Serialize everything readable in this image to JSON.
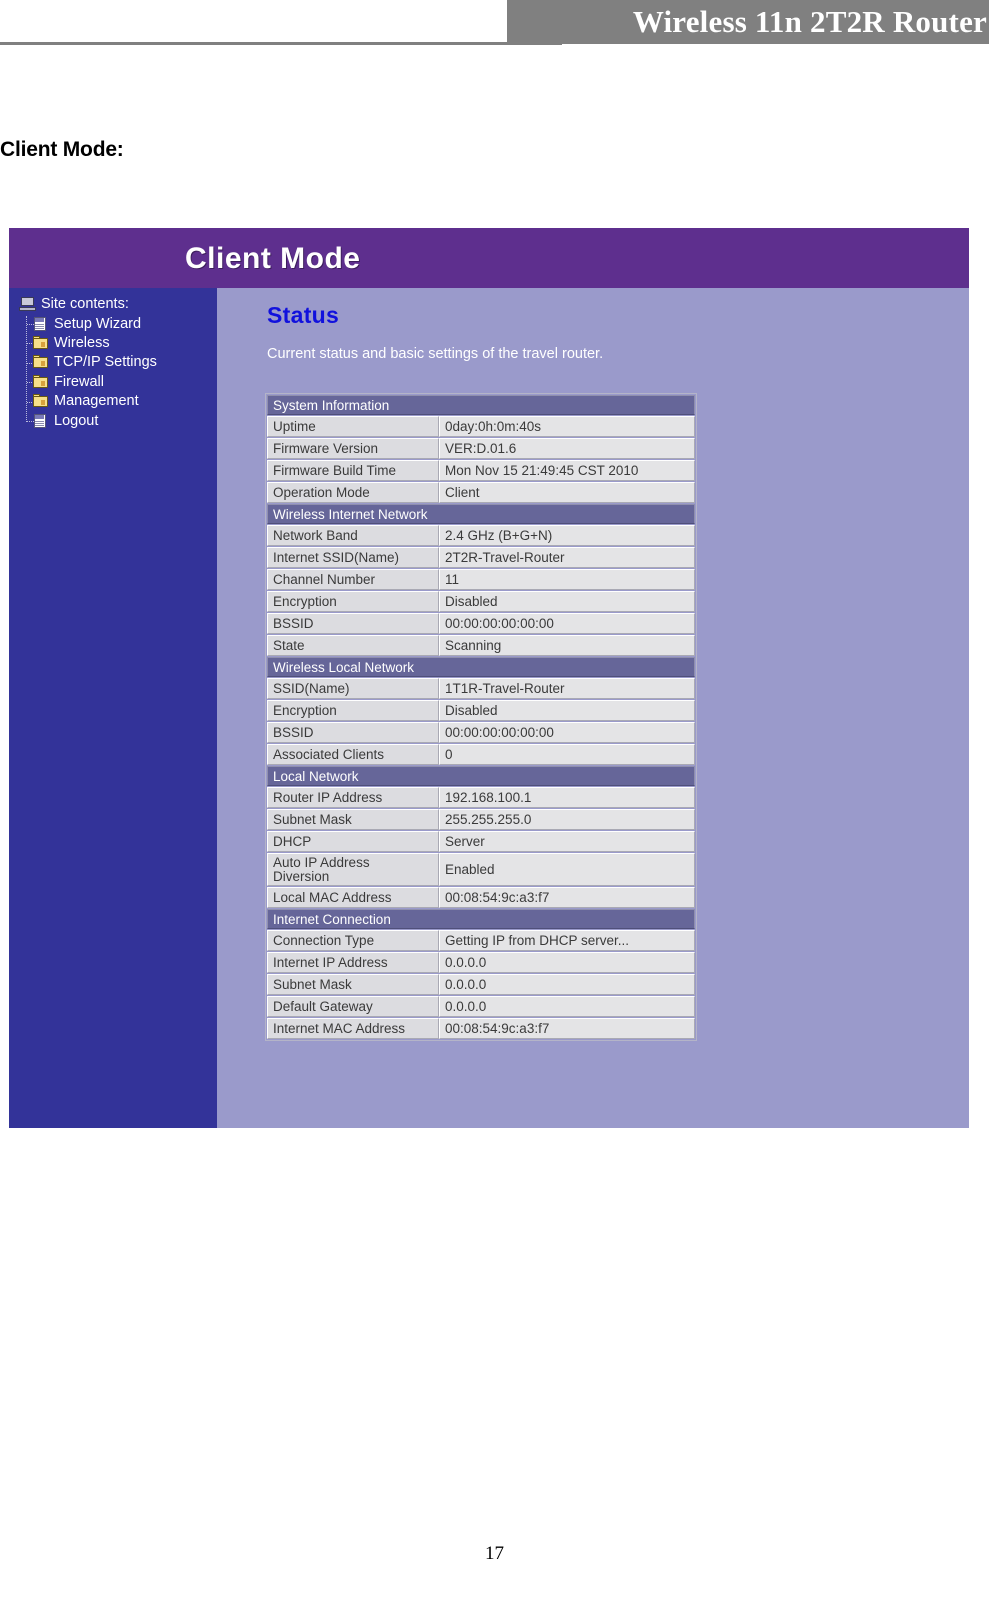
{
  "document": {
    "header_title": "Wireless 11n 2T2R Router",
    "section_caption": "Client Mode:",
    "page_number": "17"
  },
  "screenshot": {
    "mode_banner": "Client Mode",
    "sidebar": {
      "root_label": "Site contents:",
      "items": [
        {
          "label": "Setup Wizard",
          "icon": "page-icon"
        },
        {
          "label": "Wireless",
          "icon": "folder-icon"
        },
        {
          "label": "TCP/IP Settings",
          "icon": "folder-icon"
        },
        {
          "label": "Firewall",
          "icon": "folder-icon"
        },
        {
          "label": "Management",
          "icon": "folder-icon"
        },
        {
          "label": "Logout",
          "icon": "page-icon"
        }
      ]
    },
    "content": {
      "title": "Status",
      "description": "Current status and basic settings of the travel router.",
      "sections": [
        {
          "heading": "System Information",
          "rows": [
            {
              "label": "Uptime",
              "value": "0day:0h:0m:40s"
            },
            {
              "label": "Firmware Version",
              "value": "VER:D.01.6"
            },
            {
              "label": "Firmware Build Time",
              "value": "Mon Nov 15 21:49:45 CST 2010"
            },
            {
              "label": "Operation Mode",
              "value": "Client"
            }
          ]
        },
        {
          "heading": "Wireless Internet Network",
          "rows": [
            {
              "label": "Network Band",
              "value": "2.4 GHz (B+G+N)"
            },
            {
              "label": "Internet SSID(Name)",
              "value": "2T2R-Travel-Router"
            },
            {
              "label": "Channel Number",
              "value": "11"
            },
            {
              "label": "Encryption",
              "value": "Disabled"
            },
            {
              "label": "BSSID",
              "value": "00:00:00:00:00:00"
            },
            {
              "label": "State",
              "value": "Scanning"
            }
          ]
        },
        {
          "heading": "Wireless Local Network",
          "rows": [
            {
              "label": "SSID(Name)",
              "value": "1T1R-Travel-Router"
            },
            {
              "label": "Encryption",
              "value": "Disabled"
            },
            {
              "label": "BSSID",
              "value": "00:00:00:00:00:00"
            },
            {
              "label": "Associated Clients",
              "value": "0"
            }
          ]
        },
        {
          "heading": "Local Network",
          "rows": [
            {
              "label": "Router IP Address",
              "value": "192.168.100.1"
            },
            {
              "label": "Subnet Mask",
              "value": "255.255.255.0"
            },
            {
              "label": "DHCP",
              "value": "Server"
            },
            {
              "label": "Auto IP Address\nDiversion",
              "value": "Enabled",
              "tall": true
            },
            {
              "label": "Local MAC Address",
              "value": "00:08:54:9c:a3:f7"
            }
          ]
        },
        {
          "heading": "Internet Connection",
          "rows": [
            {
              "label": "Connection Type",
              "value": "Getting IP from DHCP server..."
            },
            {
              "label": "Internet IP Address",
              "value": "0.0.0.0"
            },
            {
              "label": "Subnet Mask",
              "value": "0.0.0.0"
            },
            {
              "label": "Default Gateway",
              "value": "0.0.0.0"
            },
            {
              "label": "Internet MAC Address",
              "value": "00:08:54:9c:a3:f7"
            }
          ]
        }
      ]
    }
  },
  "colors": {
    "header_banner": "#808080",
    "mode_banner": "#5e2f8e",
    "sidebar": "#333399",
    "content": "#9a9acb",
    "section_heading": "#666699",
    "status_title": "#1111dd"
  }
}
